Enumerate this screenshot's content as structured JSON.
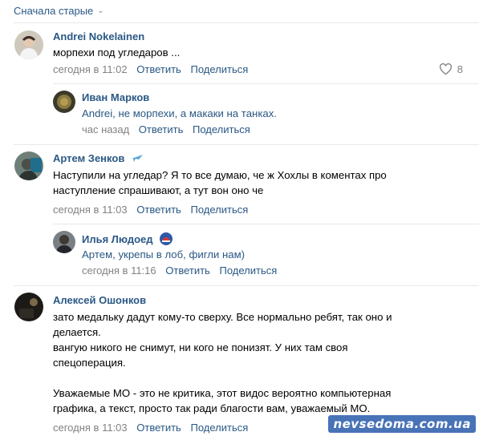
{
  "sort": {
    "label": "Сначала старые"
  },
  "comments": [
    {
      "author": "Andrei Nokelainen",
      "text": [
        "морпехи под угледаров ..."
      ],
      "time": "сегодня в 11:02",
      "reply": "Ответить",
      "share": "Поделиться",
      "likes": "8"
    },
    {
      "author": "Иван Марков",
      "text": [
        "Andrei, не морпехи, а макаки на танках."
      ],
      "time": "час назад",
      "reply": "Ответить",
      "share": "Поделиться"
    },
    {
      "author": "Артем Зенков",
      "text": [
        "Наступили на угледар? Я то все думаю, че ж Хохлы в коментах про",
        "наступление спрашивают, а тут вон оно че"
      ],
      "time": "сегодня в 11:03",
      "reply": "Ответить",
      "share": "Поделиться"
    },
    {
      "author": "Илья Людоед",
      "text": [
        "Артем, укрепы в лоб, фигли нам)"
      ],
      "time": "сегодня в 11:16",
      "reply": "Ответить",
      "share": "Поделиться"
    },
    {
      "author": "Алексей Ошонков",
      "text": [
        "зато медальку дадут кому-то сверху. Все нормально ребят, так оно и",
        "делается.",
        "вангую никого не снимут, ни кого не понизят. У них там своя",
        "спецоперация.",
        "",
        "Уважаемые МО - это не критика, этот видос вероятно компьютерная",
        "графика, а текст, просто так ради благости вам, уважаемый МО."
      ],
      "time": "сегодня в 11:03",
      "reply": "Ответить",
      "share": "Поделиться"
    }
  ],
  "watermark": "nevsedoma.com.ua",
  "colors": {
    "link": "#2a5885",
    "meta": "#828282",
    "divider": "#e7e8ec"
  }
}
